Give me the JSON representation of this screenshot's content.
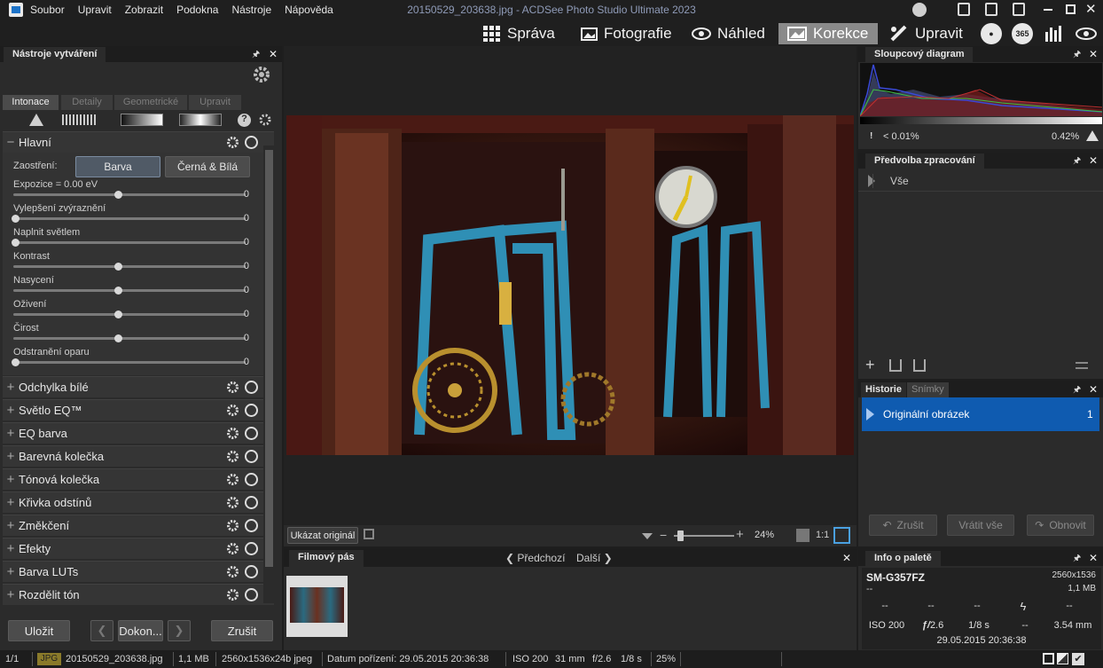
{
  "menu": [
    "Soubor",
    "Upravit",
    "Zobrazit",
    "Podokna",
    "Nástroje",
    "Nápověda"
  ],
  "window_title": "20150529_203638.jpg - ACDSee Photo Studio Ultimate 2023",
  "modes": {
    "sprava": "Správa",
    "fotografie": "Fotografie",
    "nahled": "Náhled",
    "korekce": "Korekce",
    "upravit": "Upravit",
    "badge365": "365"
  },
  "left_panel": {
    "title": "Nástroje vytváření",
    "tabs": [
      "Intonace",
      "Detaily",
      "Geometrické",
      "Upravit"
    ],
    "main_section": "Hlavní",
    "treatment_label": "Zaostření:",
    "treatment_options": [
      "Barva",
      "Černá & Bílá"
    ],
    "sliders": [
      {
        "label": "Expozice = 0.00 eV",
        "value": "0",
        "level": 0.45
      },
      {
        "label": "Vylepšení zvýraznění",
        "value": "0",
        "level": 0.0
      },
      {
        "label": "Naplnit světlem",
        "value": "0",
        "level": 0.0
      },
      {
        "label": "Kontrast",
        "value": "0",
        "level": 0.45
      },
      {
        "label": "Nasycení",
        "value": "0",
        "level": 0.45
      },
      {
        "label": "Oživení",
        "value": "0",
        "level": 0.45
      },
      {
        "label": "Čirost",
        "value": "0",
        "level": 0.45
      },
      {
        "label": "Odstranění oparu",
        "value": "0",
        "level": 0.0
      }
    ],
    "sections": [
      "Odchylka bílé",
      "Světlo EQ™",
      "EQ barva",
      "Barevná kolečka",
      "Tónová kolečka",
      "Křivka odstínů",
      "Změkčení",
      "Efekty",
      "Barva LUTs",
      "Rozdělit tón"
    ],
    "footer": {
      "save": "Uložit",
      "done": "Dokon...",
      "cancel": "Zrušit"
    }
  },
  "viewer": {
    "show_original": "Ukázat originál",
    "zoom": "24%",
    "one_to_one": "1:1"
  },
  "filmstrip": {
    "title": "Filmový pás",
    "prev": "Předchozí",
    "next": "Další"
  },
  "histogram": {
    "title": "Sloupcový diagram",
    "left_clip": "< 0.01%",
    "right_clip": "0.42%"
  },
  "presets": {
    "title": "Předvolba zpracování",
    "item": "Vše"
  },
  "history": {
    "tabs": [
      "Historie",
      "Snímky"
    ],
    "item": "Originální obrázek",
    "count": "1",
    "undo": "Zrušit",
    "revert": "Vrátit vše",
    "redo": "Obnovit"
  },
  "info": {
    "title": "Info o paletě",
    "camera": "SM-G357FZ",
    "resolution": "2560x1536",
    "dash": "--",
    "filesize": "1,1 MB",
    "row1": [
      "--",
      "--",
      "--",
      "",
      "--"
    ],
    "iso": "ISO 200",
    "fstop": "2.6",
    "shutter": "1/8 s",
    "shutter2": "--",
    "focal": "3.54 mm",
    "date": "29.05.2015 20:36:38"
  },
  "status": {
    "index": "1/1",
    "type": "JPG",
    "filename": "20150529_203638.jpg",
    "size": "1,1 MB",
    "dimensions": "2560x1536x24b jpeg",
    "date_taken": "Datum pořízení: 29.05.2015 20:36:38",
    "iso": "ISO 200",
    "focal": "31 mm",
    "fstop": "f/2.6",
    "shutter": "1/8 s",
    "zoom": "25%"
  },
  "colors": {
    "accent": "#0f5bb0",
    "active_mode": "#8a8a8a"
  }
}
